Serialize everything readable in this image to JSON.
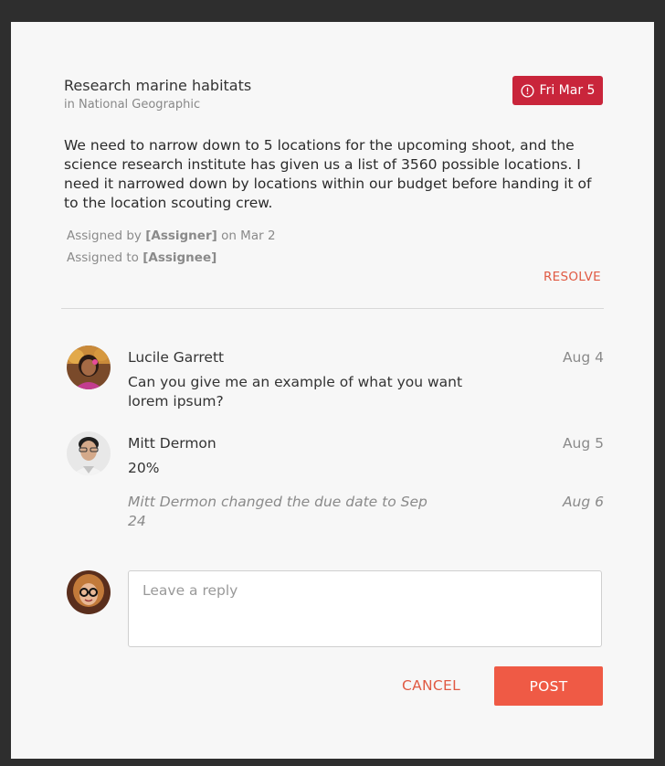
{
  "task": {
    "title": "Research marine habitats",
    "project": "in National Geographic",
    "due_badge": "Fri Mar 5",
    "due_icon": "alert-circle-icon",
    "description": "We need to narrow down to 5 locations for the upcoming shoot, and the science research institute has given us a list of 3560 possible locations. I need it narrowed down by locations within our budget before handing it of to the location scouting crew.",
    "assigned_by_prefix": "Assigned by",
    "assigner": "[Assigner]",
    "assigned_by_suffix": "on Mar 2",
    "assigned_to_prefix": "Assigned to",
    "assignee": "[Assignee]",
    "resolve_label": "RESOLVE"
  },
  "comments": [
    {
      "author": "Lucile Garrett",
      "date": "Aug 4",
      "body": "Can you give me an example of what you want lorem ipsum?"
    },
    {
      "author": "Mitt Dermon",
      "date": "Aug 5",
      "body": "20%"
    }
  ],
  "event": {
    "text": "Mitt Dermon changed the due date to Sep 24",
    "date": "Aug 6"
  },
  "reply": {
    "placeholder": "Leave a reply",
    "value": ""
  },
  "actions": {
    "cancel_label": "CANCEL",
    "post_label": "POST"
  },
  "colors": {
    "badge": "#c9253b",
    "accent": "#ef5a45",
    "link": "#e05a43",
    "backdrop": "#2e2e2e",
    "panel": "#f7f7f7"
  }
}
